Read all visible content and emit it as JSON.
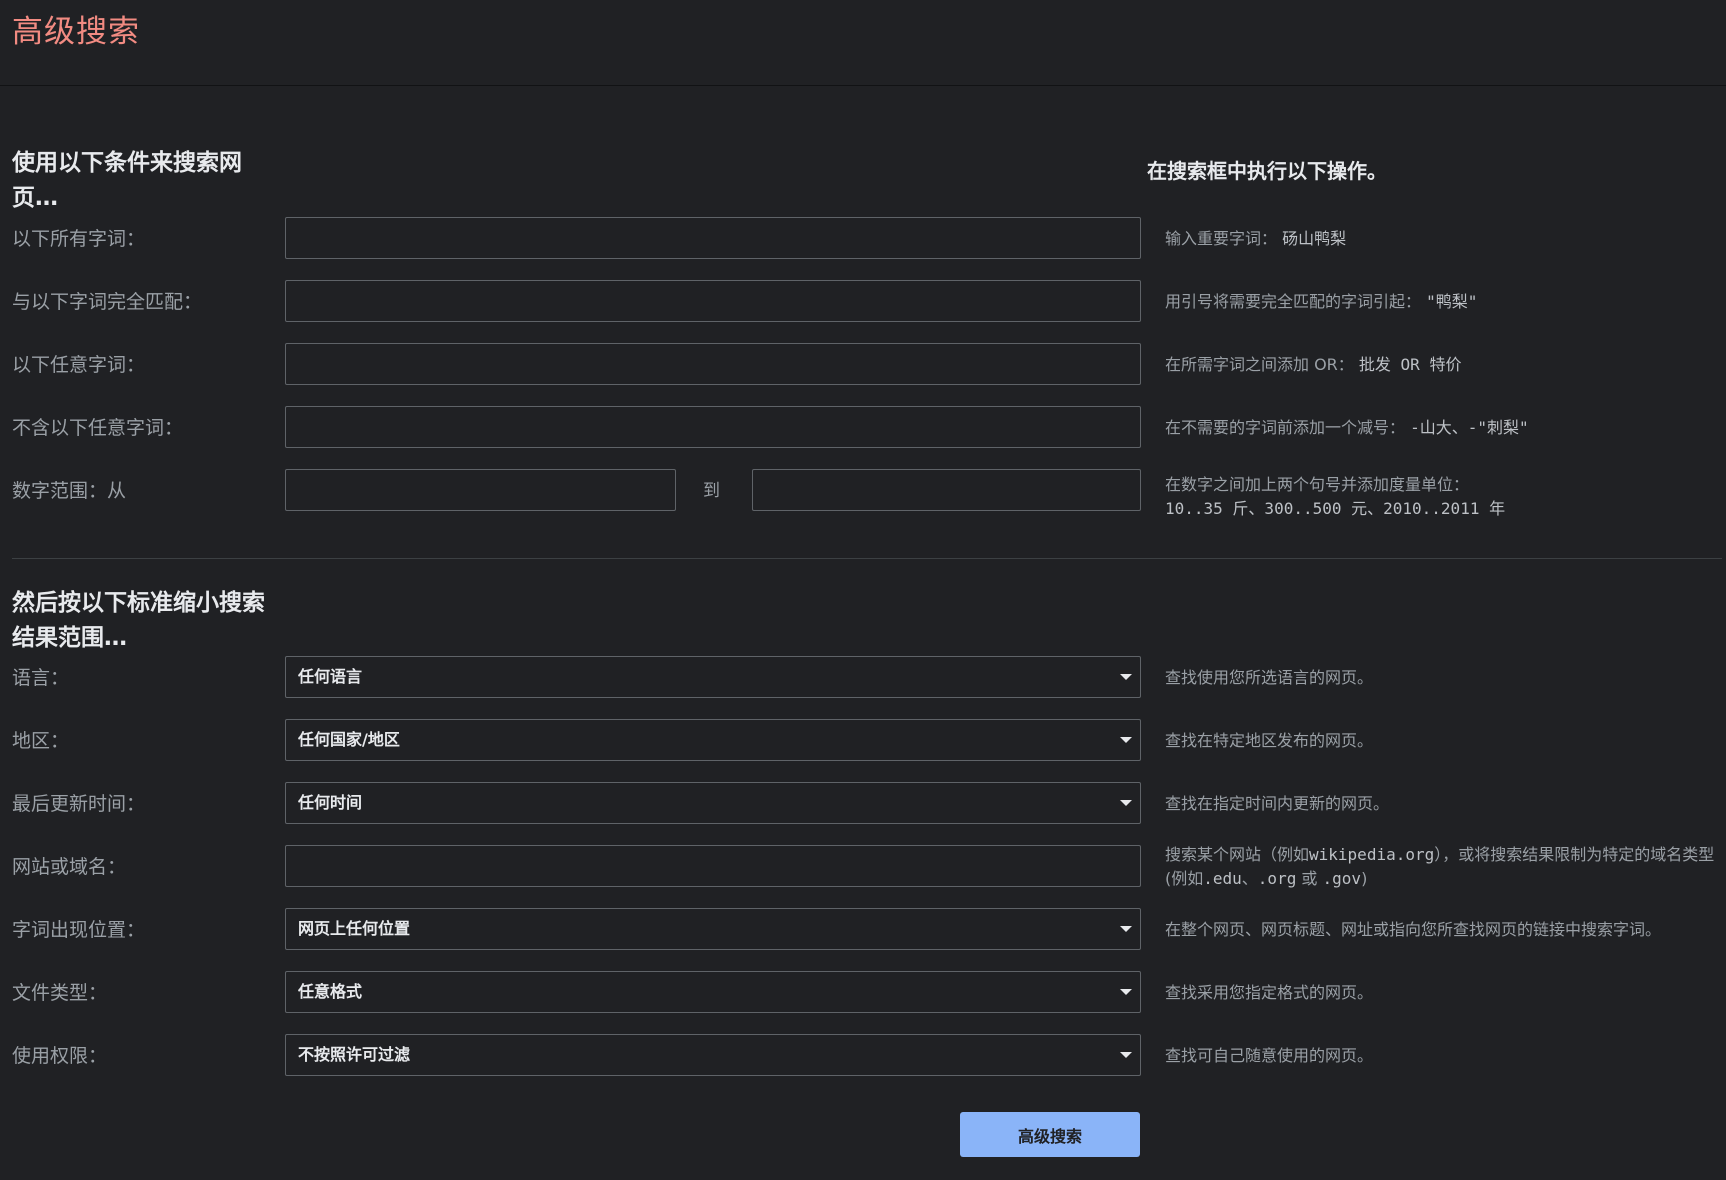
{
  "header": {
    "title": "高级搜索"
  },
  "find_section": {
    "heading_line1": "使用以下条件来搜索网",
    "heading_line2": "页…",
    "right_heading": "在搜索框中执行以下操作。",
    "rows": [
      {
        "label": "以下所有字词：",
        "hint_text": "输入重要字词：",
        "hint_example": "砀山鸭梨",
        "value": ""
      },
      {
        "label": "与以下字词完全匹配：",
        "hint_text": "用引号将需要完全匹配的字词引起：",
        "hint_example": "\"鸭梨\"",
        "value": ""
      },
      {
        "label": "以下任意字词：",
        "hint_text": "在所需字词之间添加 OR：",
        "hint_example": "批发 OR 特价",
        "value": ""
      },
      {
        "label": "不含以下任意字词：",
        "hint_text": "在不需要的字词前添加一个减号：",
        "hint_example": "-山大、-\"刺梨\"",
        "value": ""
      }
    ],
    "range": {
      "label": "数字范围：从",
      "to_label": "到",
      "from_value": "",
      "to_value": "",
      "hint_line1": "在数字之间加上两个句号并添加度量单位：",
      "hint_line2": "10..35 斤、300..500 元、2010..2011 年"
    }
  },
  "narrow_section": {
    "heading_line1": "然后按以下标准缩小搜索",
    "heading_line2": "结果范围…",
    "language": {
      "label": "语言：",
      "selected": "任何语言",
      "hint": "查找使用您所选语言的网页。"
    },
    "region": {
      "label": "地区：",
      "selected": "任何国家/地区",
      "hint": "查找在特定地区发布的网页。"
    },
    "last_update": {
      "label": "最后更新时间：",
      "selected": "任何时间",
      "hint": "查找在指定时间内更新的网页。"
    },
    "site": {
      "label": "网站或域名：",
      "value": "",
      "hint_part1": "搜索某个网站（例如",
      "hint_code1": "wikipedia.org",
      "hint_part2": "），或将搜索结果限制为特定的域名类型(例如",
      "hint_code2": ".edu",
      "hint_part3": "、",
      "hint_code3": ".org",
      "hint_part4": "或",
      "hint_code4": ".gov",
      "hint_part5": ")"
    },
    "terms_appearing": {
      "label": "字词出现位置：",
      "selected": "网页上任何位置",
      "hint": "在整个网页、网页标题、网址或指向您所查找网页的链接中搜索字词。"
    },
    "file_type": {
      "label": "文件类型：",
      "selected": "任意格式",
      "hint": "查找采用您指定格式的网页。"
    },
    "usage_rights": {
      "label": "使用权限：",
      "selected": "不按照许可过滤",
      "hint": "查找可自己随意使用的网页。"
    }
  },
  "submit": {
    "label": "高级搜索"
  },
  "colors": {
    "background": "#202124",
    "title": "#f28b82",
    "button": "#8ab4f8",
    "border": "#5f6368"
  }
}
